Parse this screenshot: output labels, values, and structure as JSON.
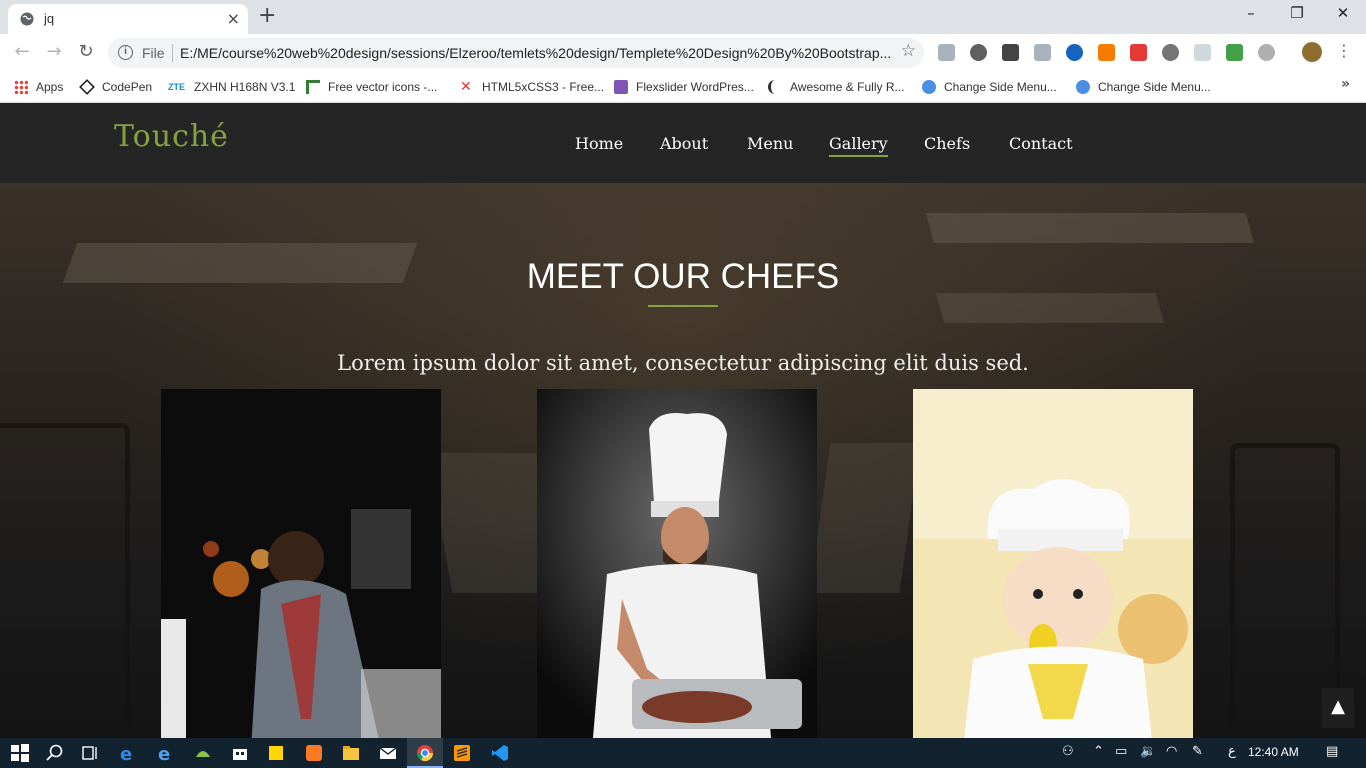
{
  "browser": {
    "tab": {
      "title": "jq",
      "close": "×"
    },
    "new_tab": "+",
    "window_controls": {
      "minimize": "–",
      "restore": "❐",
      "close": "✕"
    },
    "nav": {
      "back": "←",
      "forward": "→",
      "reload": "↻"
    },
    "omnibox": {
      "info_glyph": "i",
      "scheme": "File",
      "url": "E:/ME/course%20web%20design/sessions/Elzeroo/temlets%20design/Templete%20Design%20By%20Bootstrap...",
      "star": "☆"
    },
    "bookmarks": [
      {
        "label": "Apps",
        "icon": "apps-grid-icon",
        "color": "#4285f4"
      },
      {
        "label": "CodePen",
        "icon": "codepen-icon",
        "color": "#222222"
      },
      {
        "label": "ZXHN H168N V3.1",
        "icon": "zte-icon",
        "color": "#1e88c8"
      },
      {
        "label": "Free vector icons -...",
        "icon": "flaticon-icon",
        "color": "#2e7d32"
      },
      {
        "label": "HTML5xCSS3 - Free...",
        "icon": "html5xcss3-icon",
        "color": "#e53935"
      },
      {
        "label": "Flexslider WordPres...",
        "icon": "woo-icon",
        "color": "#7f54b3"
      },
      {
        "label": "Awesome & Fully R...",
        "icon": "moon-icon",
        "color": "#333333"
      },
      {
        "label": "Change Side Menu...",
        "icon": "globe-icon",
        "color": "#4a90e2"
      },
      {
        "label": "Change Side Menu...",
        "icon": "globe-icon",
        "color": "#4a90e2"
      }
    ],
    "bookmarks_more": "»"
  },
  "site": {
    "brand": "Touché",
    "brand_color": "#84a33f",
    "nav": [
      {
        "label": "Home",
        "active": false
      },
      {
        "label": "About",
        "active": false
      },
      {
        "label": "Menu",
        "active": false
      },
      {
        "label": "Gallery",
        "active": true
      },
      {
        "label": "Chefs",
        "active": false
      },
      {
        "label": "Contact",
        "active": false
      }
    ],
    "hero": {
      "title": "MEET OUR CHEFS",
      "subtitle": "Lorem ipsum dolor sit amet, consectetur adipiscing elit duis sed."
    },
    "chefs": [
      {
        "alt": "female-chef-cooking-photo"
      },
      {
        "alt": "male-chef-with-roasting-pan-photo"
      },
      {
        "alt": "child-in-chef-hat-photo"
      }
    ],
    "scroll_top": "▲"
  },
  "taskbar": {
    "clock": "12:40 AM",
    "lang": "ع"
  }
}
